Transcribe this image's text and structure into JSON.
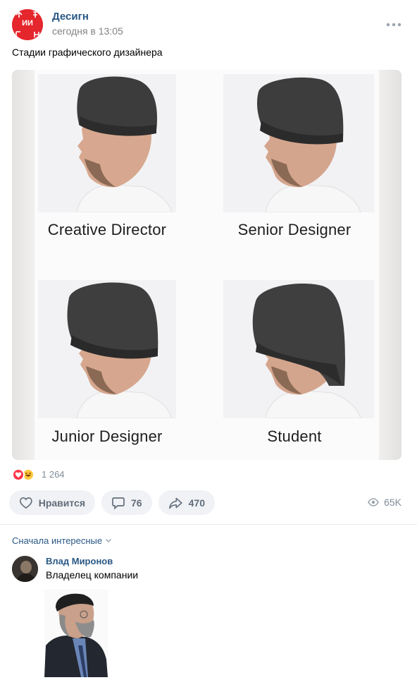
{
  "post": {
    "group_name": "Десигн",
    "time": "сегодня в 13:05",
    "text": "Стадии графического дизайнера",
    "avatar_letters": "ИИ",
    "image_captions": [
      "Creative Director",
      "Senior Designer",
      "Junior Designer",
      "Student"
    ]
  },
  "stats": {
    "reactions_count": "1 264",
    "like_label": "Нравится",
    "comments_count": "76",
    "shares_count": "470",
    "views_count": "65K"
  },
  "comments": {
    "sort_label": "Сначала интересные",
    "items": [
      {
        "author": "Влад Миронов",
        "text": "Владелец компании"
      }
    ]
  },
  "icons": [
    "more-icon",
    "heart-reaction-icon",
    "laugh-reaction-icon",
    "like-icon",
    "comment-icon",
    "share-icon",
    "eye-icon",
    "chevron-down-icon"
  ],
  "colors": {
    "link": "#2a5885",
    "muted": "#818c99",
    "button_bg": "#f0f2f5",
    "avatar_red": "#e5262d"
  }
}
